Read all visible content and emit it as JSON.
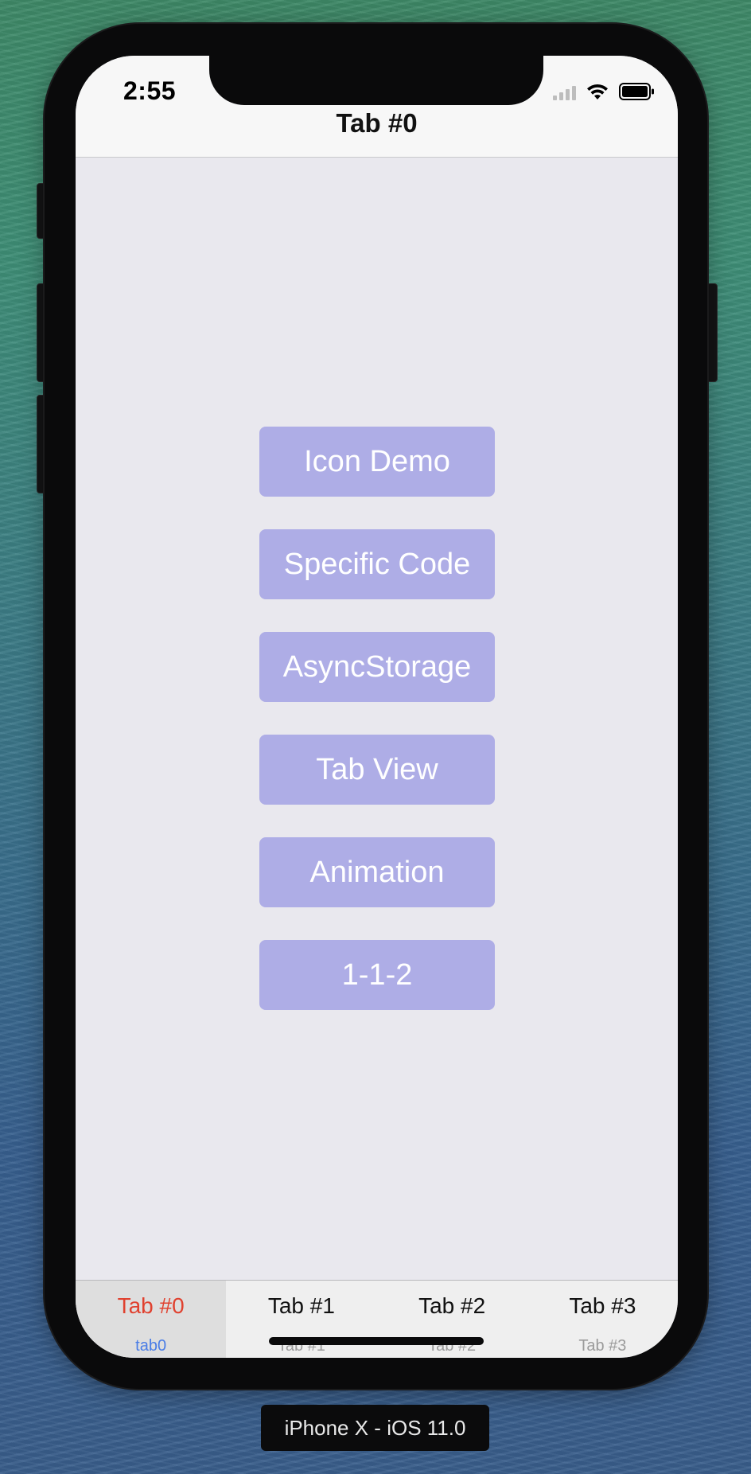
{
  "status_bar": {
    "time": "2:55",
    "icons": [
      "cellular-signal-icon",
      "wifi-icon",
      "battery-icon"
    ]
  },
  "nav": {
    "title": "Tab #0"
  },
  "menu": {
    "buttons": [
      {
        "label": "Icon Demo"
      },
      {
        "label": "Specific Code"
      },
      {
        "label": "AsyncStorage"
      },
      {
        "label": "Tab View"
      },
      {
        "label": "Animation"
      },
      {
        "label": "1-1-2"
      }
    ]
  },
  "tabbar": {
    "tabs": [
      {
        "label": "Tab #0",
        "sub": "tab0",
        "active": true
      },
      {
        "label": "Tab #1",
        "sub": "Tab #1",
        "active": false
      },
      {
        "label": "Tab #2",
        "sub": "Tab #2",
        "active": false
      },
      {
        "label": "Tab #3",
        "sub": "Tab #3",
        "active": false
      }
    ]
  },
  "device": {
    "label": "iPhone X - iOS 11.0"
  },
  "colors": {
    "button_bg": "#aeade6",
    "active_tab_label": "#e0412f",
    "active_tab_sub": "#4a7de6",
    "screen_bg": "#e9e8ee"
  }
}
